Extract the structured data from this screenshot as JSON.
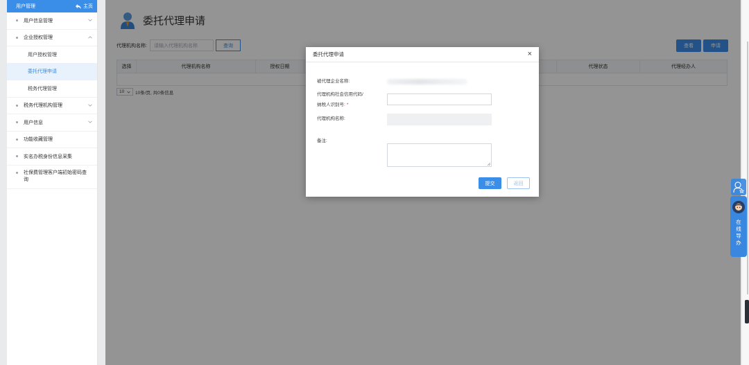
{
  "sidebar": {
    "header_title": "用户管理",
    "home_label": "主页",
    "items": [
      {
        "label": "用户信息管理"
      },
      {
        "label": "企业授权管理"
      },
      {
        "label": "用户授权管理"
      },
      {
        "label": "委托代理申请"
      },
      {
        "label": "税务代理管理"
      },
      {
        "label": "税务代理机构管理"
      },
      {
        "label": "用户信息"
      },
      {
        "label": "功能收藏管理"
      },
      {
        "label": "实名办税身份信息采集"
      },
      {
        "label": "社保费管理客户端初始密码查询"
      }
    ]
  },
  "page": {
    "title": "委托代理申请",
    "search_label": "代理机构名称:",
    "search_placeholder": "请输入代理机构名称",
    "query_button": "查询",
    "view_button": "查看",
    "apply_button": "申请",
    "columns": [
      "选择",
      "代理机构名称",
      "授权日期",
      "代理状态",
      "代理经办人"
    ],
    "pager_size": "10",
    "pager_text": "10条/页, 共0条信息"
  },
  "modal": {
    "title": "委托代理申请",
    "close_glyph": "×",
    "field_company_label": "被代理企业名称:",
    "field_credit_label_line1": "代理机构社会信用代码/",
    "field_credit_label_line2": "纳税人识别号:",
    "required_mark": "*",
    "field_agency_label": "代理机构名称:",
    "field_remark_label": "备注:",
    "submit_button": "提交",
    "back_button": "返回"
  },
  "widget": {
    "chat_label": "在线导办"
  },
  "colors": {
    "accent": "#3b8ee8",
    "overlay": "rgba(0,0,0,0.42)"
  }
}
